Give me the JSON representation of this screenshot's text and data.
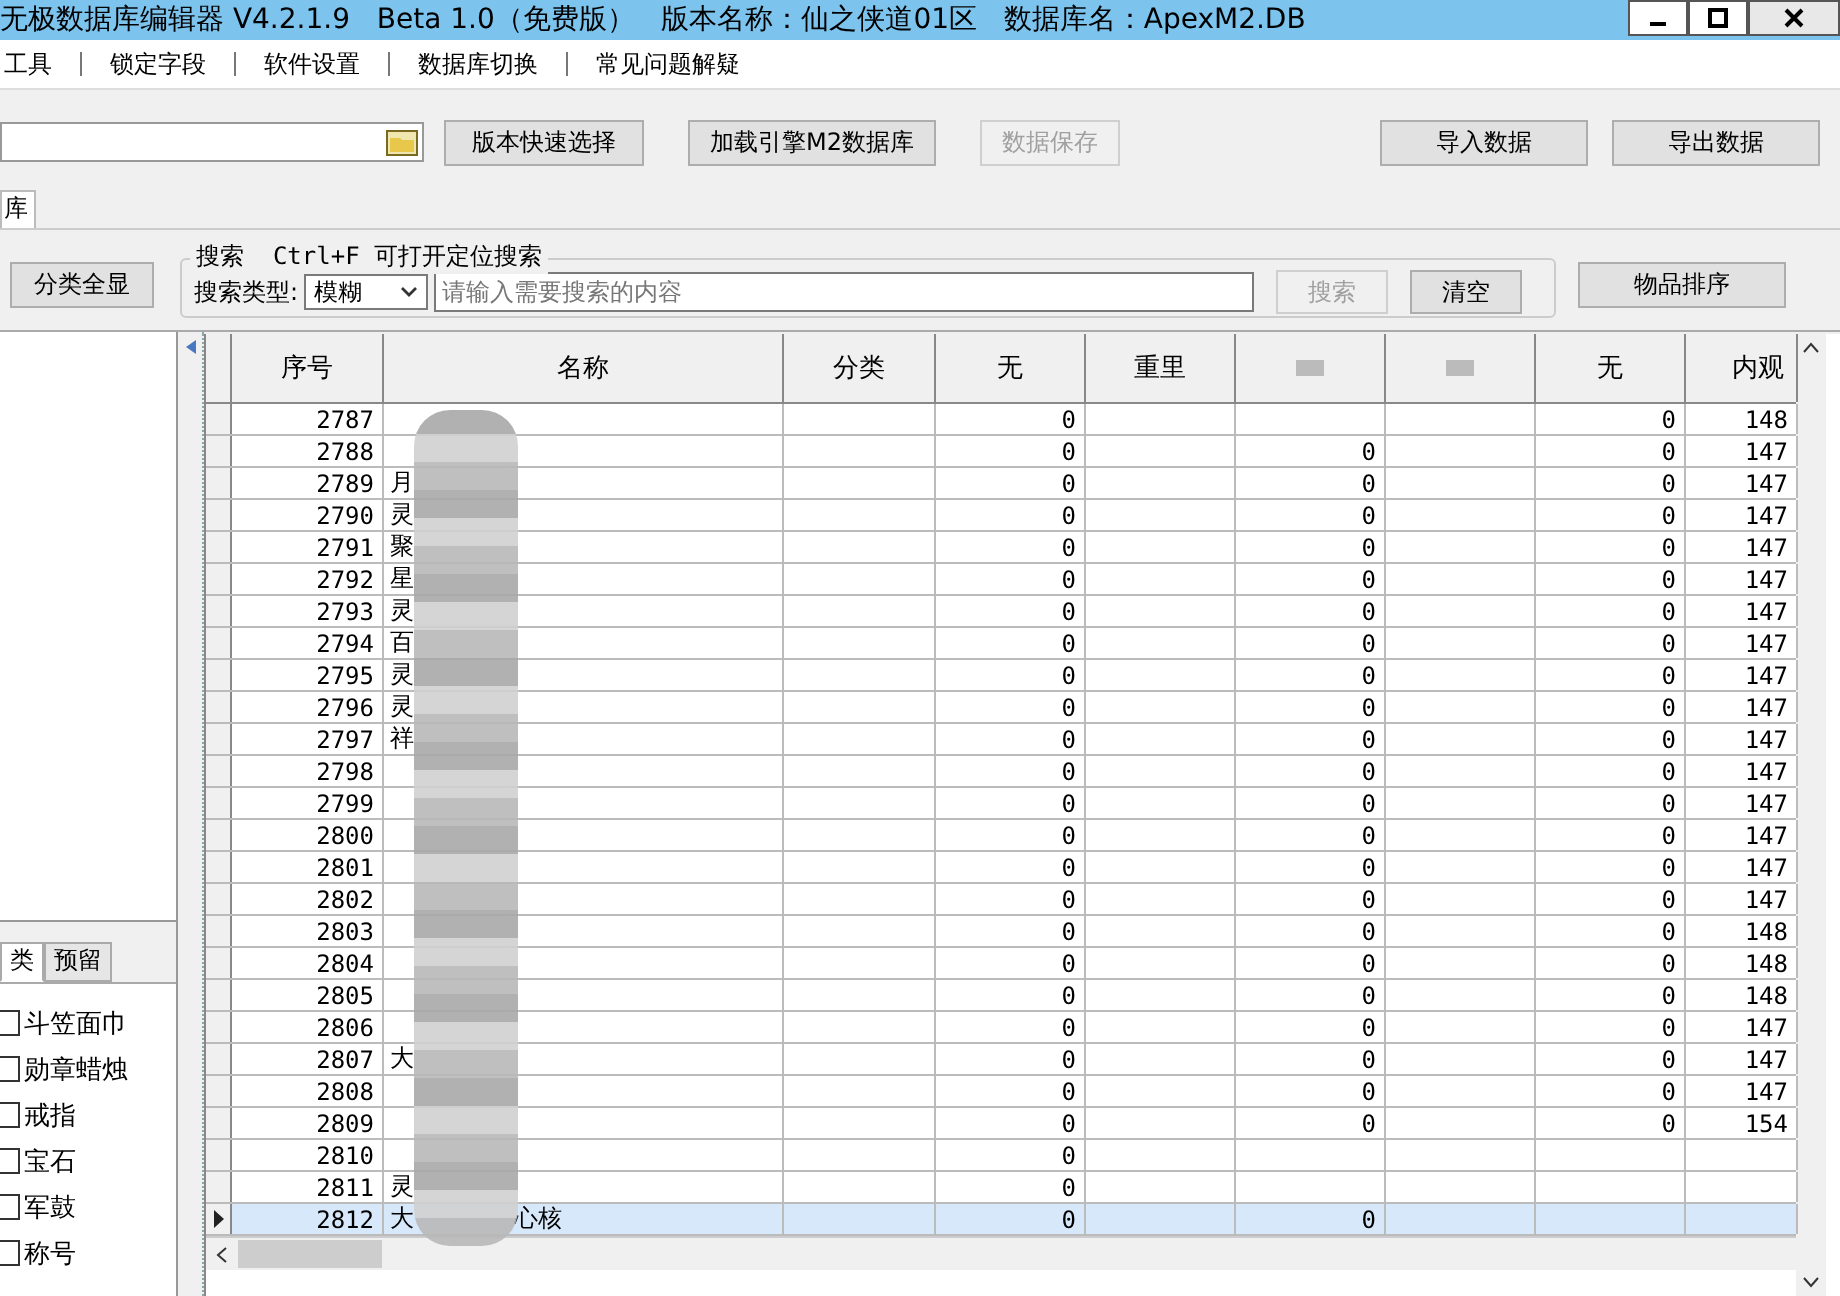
{
  "window": {
    "title": "无极数据库编辑器 V4.2.1.9   Beta 1.0（免费版）   版本名称：仙之侠道01区   数据库名：ApexM2.DB"
  },
  "menu": [
    "工具",
    "锁定字段",
    "软件设置",
    "数据库切换",
    "常见问题解疑"
  ],
  "toolbar": {
    "buttons": [
      {
        "label": "版本快速选择",
        "disabled": false
      },
      {
        "label": "加载引擎M2数据库",
        "disabled": false
      },
      {
        "label": "数据保存",
        "disabled": true
      }
    ],
    "right_buttons": [
      {
        "label": "导入数据",
        "disabled": false
      },
      {
        "label": "导出数据",
        "disabled": false
      }
    ]
  },
  "tabs": [
    {
      "label": "库",
      "selected": true
    }
  ],
  "search": {
    "show_all_button": "分类全显",
    "group_title": "搜索  Ctrl+F 可打开定位搜索",
    "type_label": "搜索类型:",
    "type_value": "模糊",
    "placeholder": "请输入需要搜索的内容",
    "search_button": {
      "label": "搜索",
      "disabled": true
    },
    "clear_button": "清空",
    "sort_button": "物品排序"
  },
  "left_tabs": [
    {
      "label": "类",
      "selected": true
    },
    {
      "label": "预留",
      "selected": false
    }
  ],
  "categories": [
    {
      "label": "斗笠面巾",
      "checked": false
    },
    {
      "label": "勋章蜡烛",
      "checked": false
    },
    {
      "label": "戒指",
      "checked": false
    },
    {
      "label": "宝石",
      "checked": false
    },
    {
      "label": "军鼓",
      "checked": false
    },
    {
      "label": "称号",
      "checked": false
    }
  ],
  "table": {
    "columns": [
      {
        "label": "序号",
        "obscured": false
      },
      {
        "label": "名称",
        "obscured": false
      },
      {
        "label": "分类",
        "obscured": false
      },
      {
        "label": "无",
        "obscured": false
      },
      {
        "label": "重里",
        "obscured": false
      },
      {
        "obscured": true
      },
      {
        "obscured": true
      },
      {
        "label": "无",
        "obscured": false
      },
      {
        "label": "内观",
        "obscured": false
      }
    ],
    "rows": [
      {
        "no": "2787",
        "c3": "0",
        "c7": "0",
        "c8": "148",
        "selected": false
      },
      {
        "no": "2788",
        "c3": "0",
        "c5": "0",
        "c7": "0",
        "c8": "147",
        "selected": false
      },
      {
        "no": "2789",
        "name": "月",
        "c3": "0",
        "c5": "0",
        "c7": "0",
        "c8": "147",
        "selected": false
      },
      {
        "no": "2790",
        "name": "灵",
        "c3": "0",
        "c5": "0",
        "c7": "0",
        "c8": "147",
        "selected": false
      },
      {
        "no": "2791",
        "name": "聚",
        "c3": "0",
        "c5": "0",
        "c7": "0",
        "c8": "147",
        "selected": false
      },
      {
        "no": "2792",
        "name": "星",
        "c3": "0",
        "c5": "0",
        "c7": "0",
        "c8": "147",
        "selected": false
      },
      {
        "no": "2793",
        "name": "灵",
        "c3": "0",
        "c5": "0",
        "c7": "0",
        "c8": "147",
        "selected": false
      },
      {
        "no": "2794",
        "name": "百",
        "c3": "0",
        "c5": "0",
        "c7": "0",
        "c8": "147",
        "selected": false
      },
      {
        "no": "2795",
        "name": "灵",
        "c3": "0",
        "c5": "0",
        "c7": "0",
        "c8": "147",
        "selected": false
      },
      {
        "no": "2796",
        "name": "灵",
        "c3": "0",
        "c5": "0",
        "c7": "0",
        "c8": "147",
        "selected": false
      },
      {
        "no": "2797",
        "name": "祥",
        "c3": "0",
        "c5": "0",
        "c7": "0",
        "c8": "147",
        "selected": false
      },
      {
        "no": "2798",
        "c3": "0",
        "c5": "0",
        "c7": "0",
        "c8": "147",
        "selected": false
      },
      {
        "no": "2799",
        "c3": "0",
        "c5": "0",
        "c7": "0",
        "c8": "147",
        "selected": false
      },
      {
        "no": "2800",
        "c3": "0",
        "c5": "0",
        "c7": "0",
        "c8": "147",
        "selected": false
      },
      {
        "no": "2801",
        "c3": "0",
        "c5": "0",
        "c7": "0",
        "c8": "147",
        "selected": false
      },
      {
        "no": "2802",
        "c3": "0",
        "c5": "0",
        "c7": "0",
        "c8": "147",
        "selected": false
      },
      {
        "no": "2803",
        "c3": "0",
        "c5": "0",
        "c7": "0",
        "c8": "148",
        "selected": false
      },
      {
        "no": "2804",
        "c3": "0",
        "c5": "0",
        "c7": "0",
        "c8": "148",
        "selected": false
      },
      {
        "no": "2805",
        "c3": "0",
        "c5": "0",
        "c7": "0",
        "c8": "148",
        "selected": false
      },
      {
        "no": "2806",
        "c3": "0",
        "c5": "0",
        "c7": "0",
        "c8": "147",
        "selected": false
      },
      {
        "no": "2807",
        "name": "大",
        "c3": "0",
        "c5": "0",
        "c7": "0",
        "c8": "147",
        "selected": false
      },
      {
        "no": "2808",
        "c3": "0",
        "c5": "0",
        "c7": "0",
        "c8": "147",
        "selected": false
      },
      {
        "no": "2809",
        "c3": "0",
        "c5": "0",
        "c7": "0",
        "c8": "154",
        "selected": false
      },
      {
        "no": "2810",
        "c3": "0",
        "selected": false
      },
      {
        "no": "2811",
        "name": "灵",
        "c3": "0",
        "selected": false
      },
      {
        "no": "2812",
        "name": "大",
        "name_tail": "心核",
        "c3": "0",
        "c5": "0",
        "selected": true
      }
    ]
  }
}
